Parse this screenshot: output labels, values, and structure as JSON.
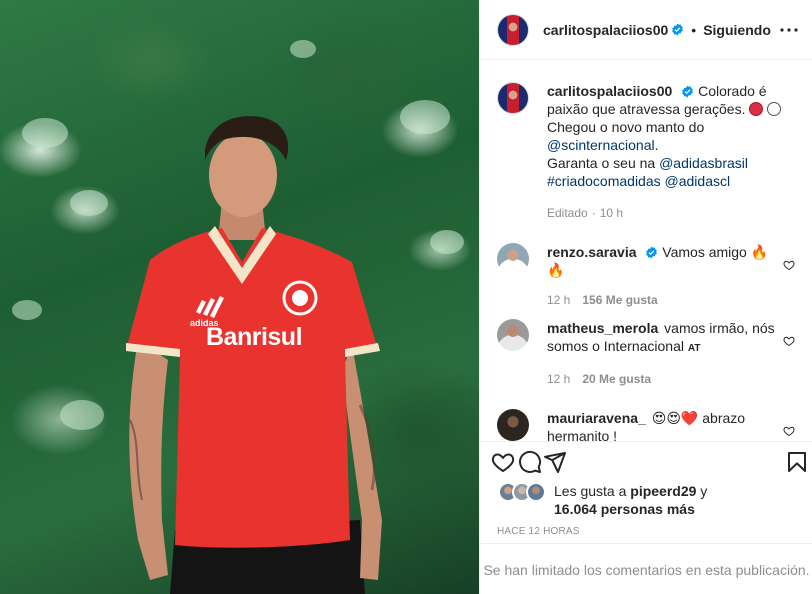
{
  "post": {
    "username": "carlitospalaciios00",
    "follow_status": "Siguiendo",
    "separator": "•"
  },
  "caption": {
    "username": "carlitospalaciios00",
    "line1": "Colorado é paixão que atravessa gerações.",
    "line2": "Chegou o novo manto do",
    "mention1": "@scinternacional",
    "line3_suffix": ".",
    "line4_prefix": "Garanta o seu na ",
    "mention2": "@adidasbrasil",
    "hashtag": "#criadocomadidas",
    "mention3": "@adidascl",
    "edited": "Editado",
    "time_sep": "·",
    "time": "10 h"
  },
  "comments": [
    {
      "username": "renzo.saravia",
      "verified": true,
      "text": "Vamos amigo 🔥🔥",
      "time": "12 h",
      "likes": "156 Me gusta"
    },
    {
      "username": "matheus_merola",
      "verified": false,
      "text": "vamos irmão, nós somos o Internacional",
      "badge": "AT",
      "time": "12 h",
      "likes": "20 Me gusta"
    },
    {
      "username": "mauriaravena_",
      "verified": false,
      "text": "😍😍❤️ abrazo hermanito !"
    }
  ],
  "likes": {
    "prefix": "Les gusta a ",
    "user": "pipeerd29",
    "middle": " y",
    "count": "16.064 personas más"
  },
  "timestamp": "HACE 12 HORAS",
  "comments_limited": "Se han limitado los comentarios en esta publicación.",
  "image": {
    "jersey_sponsor": "Banrisul",
    "jersey_brand": "adidas"
  },
  "colors": {
    "verified_blue": "#0095f6",
    "link_blue": "#00376b",
    "muted": "#8e8e8e",
    "jersey_red": "#e8332f"
  }
}
